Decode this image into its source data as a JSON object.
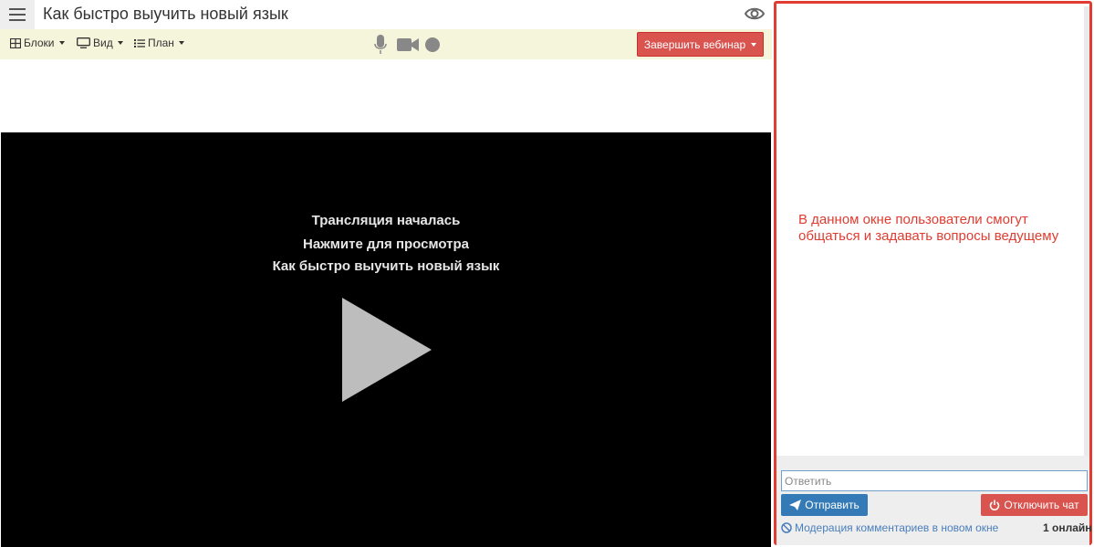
{
  "header": {
    "title": "Как быстро выучить новый язык",
    "menu_icon": "hamburger-icon",
    "view_icon": "eye-icon"
  },
  "toolbar": {
    "blocks_label": "Блоки",
    "view_label": "Вид",
    "plan_label": "План",
    "end_webinar_label": "Завершить вебинар",
    "icons": [
      "grid-icon",
      "monitor-icon",
      "list-icon",
      "microphone-icon",
      "camera-icon",
      "record-icon"
    ]
  },
  "video": {
    "line1": "Трансляция началась",
    "line2": "Нажмите для просмотра",
    "line3": "Как быстро выучить новый язык",
    "play_icon": "play-icon"
  },
  "chat": {
    "note": "В данном окне пользователи смогут общаться и задавать вопросы ведущему",
    "reply_placeholder": "Ответить",
    "send_label": "Отправить",
    "disable_label": "Отключить чат",
    "moderation_label": "Модерация комментариев в новом окне",
    "online_label": "1 онлайн"
  },
  "colors": {
    "toolbar_bg": "#f5f5dc",
    "danger": "#d9534f",
    "primary": "#337ab7",
    "highlight_border": "#e03c31"
  }
}
